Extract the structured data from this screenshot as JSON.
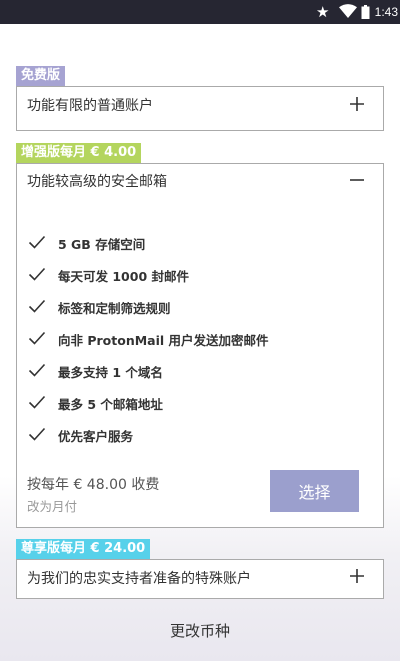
{
  "status_bar": {
    "time": "1:43",
    "icons": [
      "star-icon",
      "wifi-icon",
      "battery-icon"
    ]
  },
  "plans": {
    "free": {
      "tag": "免费版",
      "description": "功能有限的普通账户",
      "expanded": false,
      "tag_color": "#a6a3d2"
    },
    "plus": {
      "tag": "增强版每月 € 4.00",
      "description": "功能较高级的安全邮箱",
      "expanded": true,
      "tag_color": "#b4d55e",
      "features": [
        "5 GB 存储空间",
        "每天可发 1000 封邮件",
        "标签和定制筛选规则",
        "向非 ProtonMail 用户发送加密邮件",
        "最多支持 1 个域名",
        "最多 5 个邮箱地址",
        "优先客户服务"
      ],
      "price_text": "按每年 € 48.00 收费",
      "switch_billing": "改为月付",
      "select_label": "选择",
      "select_color": "#9b9fcd"
    },
    "visionary": {
      "tag": "尊享版每月 € 24.00",
      "description": "为我们的忠实支持者准备的特殊账户",
      "expanded": false,
      "tag_color": "#57d1ea"
    }
  },
  "change_currency": "更改币种"
}
